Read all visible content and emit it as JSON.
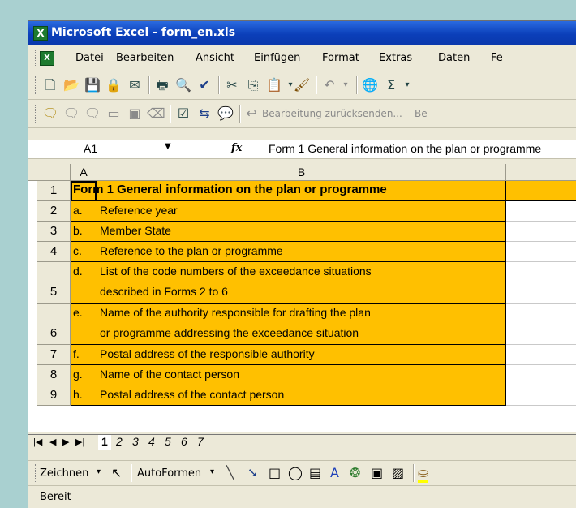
{
  "window": {
    "title": "Microsoft Excel - form_en.xls",
    "app_icon": "excel-icon"
  },
  "menu": [
    "Datei",
    "Bearbeiten",
    "Ansicht",
    "Einfügen",
    "Format",
    "Extras",
    "Daten",
    "Fe"
  ],
  "review_toolbar": {
    "send_back_label": "Bearbeitung zurücksenden...",
    "truncated_label": "Be"
  },
  "formula_bar": {
    "name_box": "A1",
    "fx": "fx",
    "value": "Form 1 General information on the plan or programme"
  },
  "sheet": {
    "columns": [
      "A",
      "B"
    ],
    "rows": [
      {
        "num": "1",
        "a": "",
        "b": "Form 1 General information on the plan or programme"
      },
      {
        "num": "2",
        "a": "a.",
        "b": "Reference year"
      },
      {
        "num": "3",
        "a": "b.",
        "b": "Member State"
      },
      {
        "num": "4",
        "a": "c.",
        "b": "Reference to the plan or programme"
      },
      {
        "num": "5",
        "a": "d.",
        "b1": "List of the code numbers of the exceedance situations",
        "b2": "described in Forms 2 to 6"
      },
      {
        "num": "6",
        "a": "e.",
        "b1": "Name of the authority responsible for drafting the plan",
        "b2": "or programme addressing the exceedance situation"
      },
      {
        "num": "7",
        "a": "f.",
        "b": "Postal address of the responsible authority"
      },
      {
        "num": "8",
        "a": "g.",
        "b": "Name of the contact person"
      },
      {
        "num": "9",
        "a": "h.",
        "b": "Postal address of the contact person"
      }
    ]
  },
  "sheet_tabs": [
    "1",
    "2",
    "3",
    "4",
    "5",
    "6",
    "7"
  ],
  "active_tab": "1",
  "drawing_toolbar": {
    "draw": "Zeichnen",
    "autoshapes": "AutoFormen"
  },
  "status": "Bereit",
  "colors": {
    "cell_fill": "#ffc000",
    "titlebar": "#0b3fb9"
  }
}
